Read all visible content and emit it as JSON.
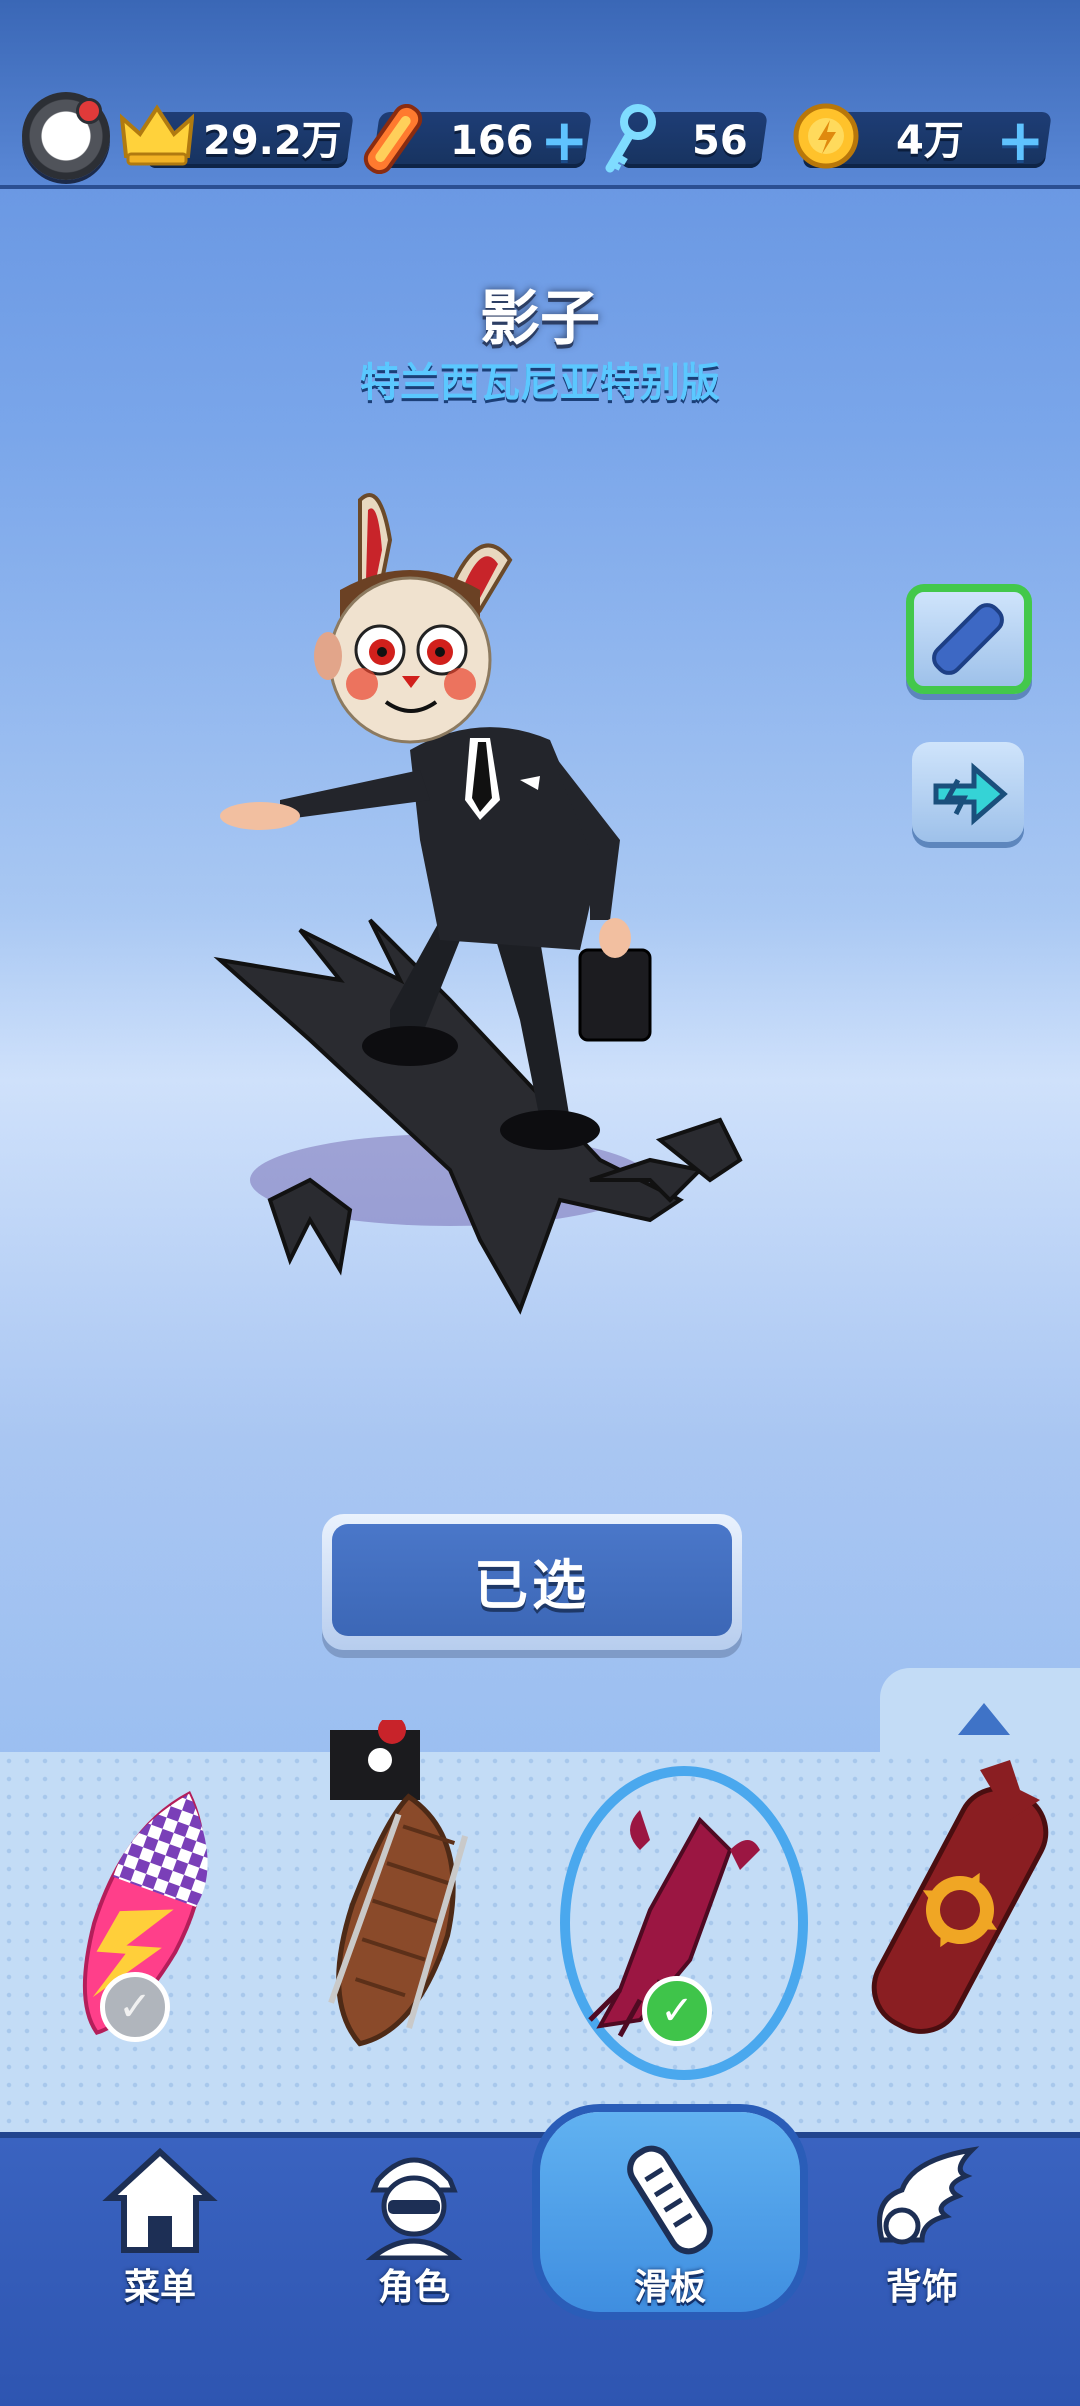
{
  "topbar": {
    "trophies": "29.2万",
    "boards": "166",
    "keys": "56",
    "coins": "4万",
    "plus_symbol": "+"
  },
  "character": {
    "name": "影子",
    "subtitle": "特兰西瓦尼亚特别版"
  },
  "actions": {
    "selected_label": "已选"
  },
  "boards": [
    {
      "icon": "surfboard-checkered-icon",
      "status": "owned"
    },
    {
      "icon": "pirate-ship-board-icon",
      "status": "none"
    },
    {
      "icon": "bat-wing-board-icon",
      "status": "selected"
    },
    {
      "icon": "wolf-board-icon",
      "status": "none"
    }
  ],
  "check_mark": "✓",
  "nav": {
    "menu": "菜单",
    "characters": "角色",
    "boards": "滑板",
    "accessories": "背饰"
  },
  "colors": {
    "accent_blue": "#3c67b6",
    "selected_green": "#3fc44a",
    "subtitle_cyan": "#5bc8ff"
  }
}
